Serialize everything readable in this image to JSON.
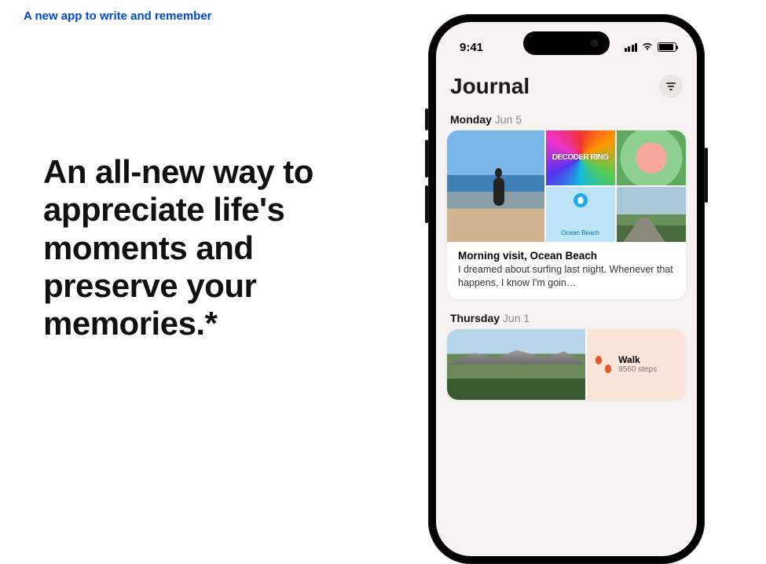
{
  "tagline": "A new app to write and remember",
  "headline": "An all-new way to appreciate life's moments and preserve your memories.*",
  "phone": {
    "status": {
      "time": "9:41"
    },
    "app": {
      "title": "Journal"
    },
    "days": [
      {
        "weekday": "Monday",
        "date": "Jun 5",
        "entry": {
          "title": "Morning visit, Ocean Beach",
          "snippet": "I dreamed about surfing last night. Whenever that happens, I know I'm goin…",
          "podcast_art_text": "DECODER RING",
          "map_label": "Ocean Beach"
        }
      },
      {
        "weekday": "Thursday",
        "date": "Jun 1",
        "walk": {
          "label": "Walk",
          "steps": "9560 steps"
        }
      }
    ]
  }
}
